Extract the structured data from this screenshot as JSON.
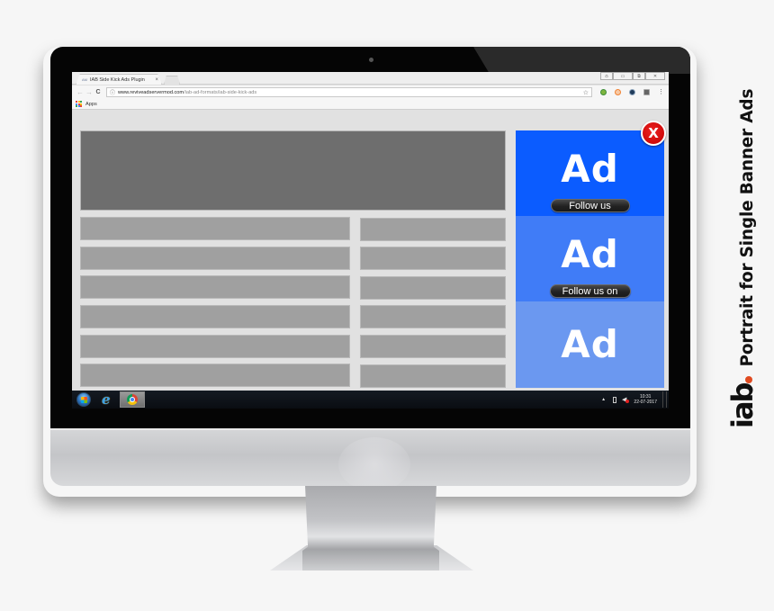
{
  "browser": {
    "tab": {
      "favicon": "AM",
      "title": "IAB Side Kick Ads Plugin",
      "close": "×"
    },
    "window_controls": [
      "user-icon",
      "minimize-icon",
      "restore-icon",
      "close-icon"
    ],
    "window_control_glyphs": [
      "⍝",
      "▭",
      "⧉",
      "✕"
    ],
    "nav": {
      "back": "←",
      "forward": "→",
      "reload": "C"
    },
    "address": {
      "info_icon": "ⓘ",
      "host": "www.reviveadservermod.com",
      "path": "/iab-ad-formats/iab-side-kick-ads"
    },
    "bookmark_star": "☆",
    "extensions": [
      "green-extension-icon",
      "orange-extension-icon",
      "blue-extension-icon",
      "gray-extension-icon"
    ],
    "menu": "⋮",
    "bookmarks_bar": {
      "apps_label": "Apps"
    }
  },
  "page": {
    "content_rows": 6,
    "side_kick_ads": {
      "close_label": "X",
      "slots": [
        {
          "label": "Ad",
          "button": "Follow us",
          "color": "#0b5cff"
        },
        {
          "label": "Ad",
          "button": "Follow us on",
          "color": "#407cf7"
        },
        {
          "label": "Ad",
          "button": null,
          "color": "#6b98f0"
        }
      ]
    }
  },
  "taskbar": {
    "apps": [
      "windows-start-orb",
      "internet-explorer-icon",
      "chrome-icon"
    ],
    "tray": {
      "time": "10:31",
      "date": "22-07-2017"
    }
  },
  "branding": {
    "logo": "iab",
    "tagline": "Portrait for Single Banner Ads",
    "accent": "#e04a20"
  }
}
